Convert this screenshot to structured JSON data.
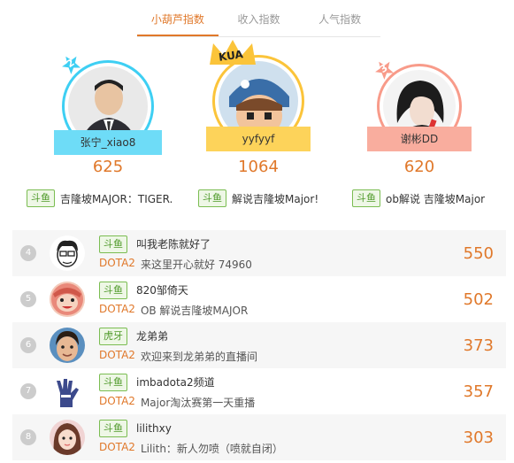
{
  "tabs": [
    {
      "label": "小葫芦指数",
      "active": true
    },
    {
      "label": "收入指数",
      "active": false
    },
    {
      "label": "人气指数",
      "active": false
    }
  ],
  "top3": [
    {
      "rank": "2",
      "name": "张宁_xiao8",
      "score": "625",
      "platform": "斗鱼",
      "desc": "吉隆坡MAJOR：TIGER.",
      "color": "#3ecff3"
    },
    {
      "rank": "1",
      "name": "yyfyyf",
      "score": "1064",
      "platform": "斗鱼",
      "desc": "解说吉隆坡Major!",
      "color": "#fbc43a",
      "crown_text": "KUA"
    },
    {
      "rank": "3",
      "name": "谢彬DD",
      "score": "620",
      "platform": "斗鱼",
      "desc": "ob解说 吉隆坡Major",
      "color": "#f89b8a"
    }
  ],
  "list": [
    {
      "rank": "4",
      "platform": "斗鱼",
      "name": "叫我老陈就好了",
      "game": "DOTA2",
      "desc": "来这里开心就好 74960",
      "score": "550"
    },
    {
      "rank": "5",
      "platform": "斗鱼",
      "name": "820邹倚天",
      "game": "DOTA2",
      "desc": "OB 解说吉隆坡MAJOR",
      "score": "502"
    },
    {
      "rank": "6",
      "platform": "虎牙",
      "name": "龙弟弟",
      "game": "DOTA2",
      "desc": "欢迎来到龙弟弟的直播间",
      "score": "373"
    },
    {
      "rank": "7",
      "platform": "斗鱼",
      "name": "imbadota2频道",
      "game": "DOTA2",
      "desc": "Major淘汰赛第一天重播",
      "score": "357"
    },
    {
      "rank": "8",
      "platform": "斗鱼",
      "name": "lilithxy",
      "game": "DOTA2",
      "desc": "Lilith：新人勿喷（喷就自闭）",
      "score": "303"
    }
  ]
}
